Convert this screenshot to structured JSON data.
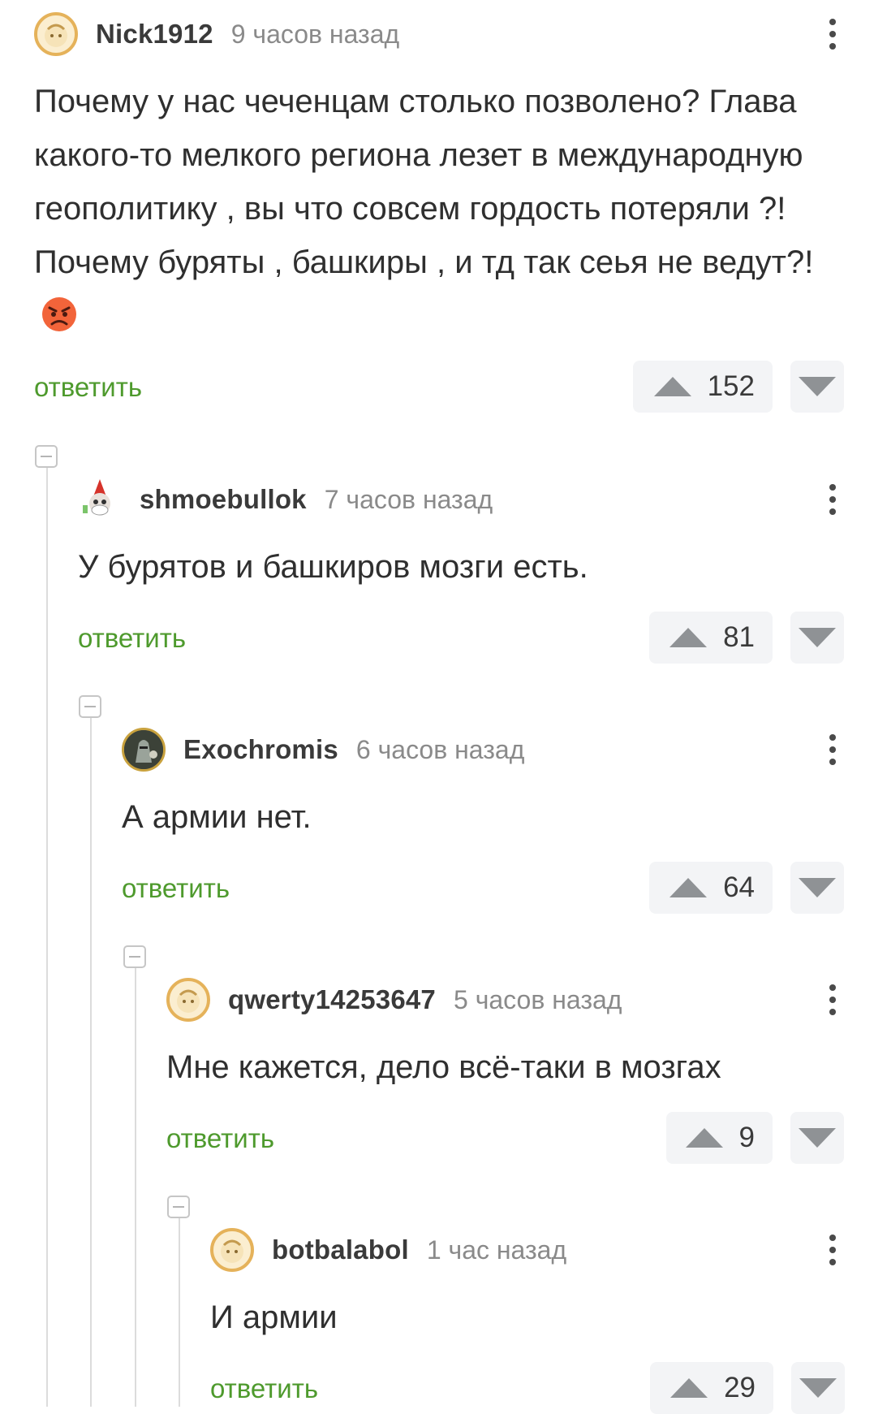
{
  "comments": [
    {
      "username": "Nick1912",
      "time": "9 часов назад",
      "text": "Почему у нас чеченцам столько позволено? Глава какого-то мелкого региона лезет в международную геополитику , вы что совсем гордость потеряли ?! Почему буряты , башкиры , и тд так сеья не ведут?!",
      "emoji": "angry-face",
      "reply_label": "ответить",
      "score": "152",
      "avatar": "default-avatar"
    },
    {
      "username": "shmoebullok",
      "time": "7 часов назад",
      "text": "У бурятов и башкиров мозги есть.",
      "reply_label": "ответить",
      "score": "81",
      "avatar": "gnome-avatar"
    },
    {
      "username": "Exochromis",
      "time": "6 часов назад",
      "text": "А армии нет.",
      "reply_label": "ответить",
      "score": "64",
      "avatar": "knight-avatar"
    },
    {
      "username": "qwerty14253647",
      "time": "5 часов назад",
      "text": "Мне кажется, дело всё-таки в мозгах",
      "reply_label": "ответить",
      "score": "9",
      "avatar": "default-avatar"
    },
    {
      "username": "botbalabol",
      "time": "1 час назад",
      "text": "И армии",
      "reply_label": "ответить",
      "score": "29",
      "avatar": "default-avatar"
    }
  ],
  "colors": {
    "accent_green": "#4e9a2d",
    "avatar_border": "#e5b25a",
    "vote_bg": "#f3f4f6"
  }
}
